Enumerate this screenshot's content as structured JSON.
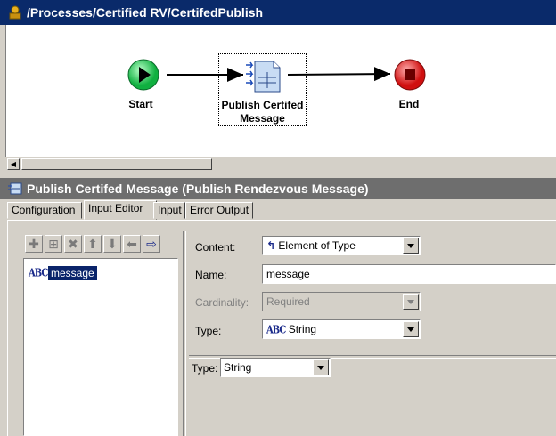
{
  "window": {
    "title": "/Processes/Certified RV/CertifedPublish"
  },
  "diagram": {
    "nodes": [
      {
        "id": "start",
        "label": "Start",
        "icon": "play-icon"
      },
      {
        "id": "publish",
        "label_line1": "Publish Certifed",
        "label_line2": "Message",
        "icon": "rv-publish-icon"
      },
      {
        "id": "end",
        "label": "End",
        "icon": "stop-icon"
      }
    ]
  },
  "panel": {
    "title": "Publish Certifed Message (Publish Rendezvous Message)",
    "tabs": [
      "Configuration",
      "Input Editor",
      "Input",
      "Error Output"
    ],
    "active_tab": "Input Editor"
  },
  "tree": {
    "toolbar_icons": [
      "add-icon",
      "add-child-icon",
      "delete-icon",
      "move-up-icon",
      "move-down-icon",
      "move-left-icon",
      "move-right-icon"
    ],
    "items": [
      {
        "label": "message",
        "icon": "abc-string-icon",
        "selected": true
      }
    ],
    "abc_glyph": "ABC"
  },
  "form": {
    "content_label": "Content:",
    "content_value": "Element of Type",
    "name_label": "Name:",
    "name_value": "message",
    "cardinality_label": "Cardinality:",
    "cardinality_value": "Required",
    "type_label": "Type:",
    "type_value": "String",
    "sub_type_label": "Type:",
    "sub_type_value": "String"
  }
}
